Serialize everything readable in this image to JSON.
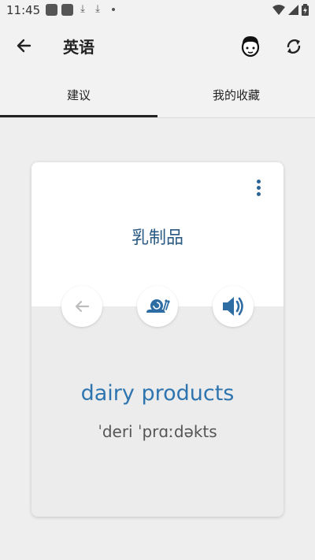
{
  "status_bar": {
    "time": "11:45"
  },
  "app_bar": {
    "title": "英语"
  },
  "tabs": [
    {
      "label": "建议"
    },
    {
      "label": "我的收藏"
    }
  ],
  "card": {
    "chinese": "乳制品",
    "english": "dairy products",
    "phonetic": "ˈderi ˈprɑːdəkts"
  },
  "colors": {
    "accent": "#2e75b0",
    "word_dark": "#2a5a83"
  }
}
